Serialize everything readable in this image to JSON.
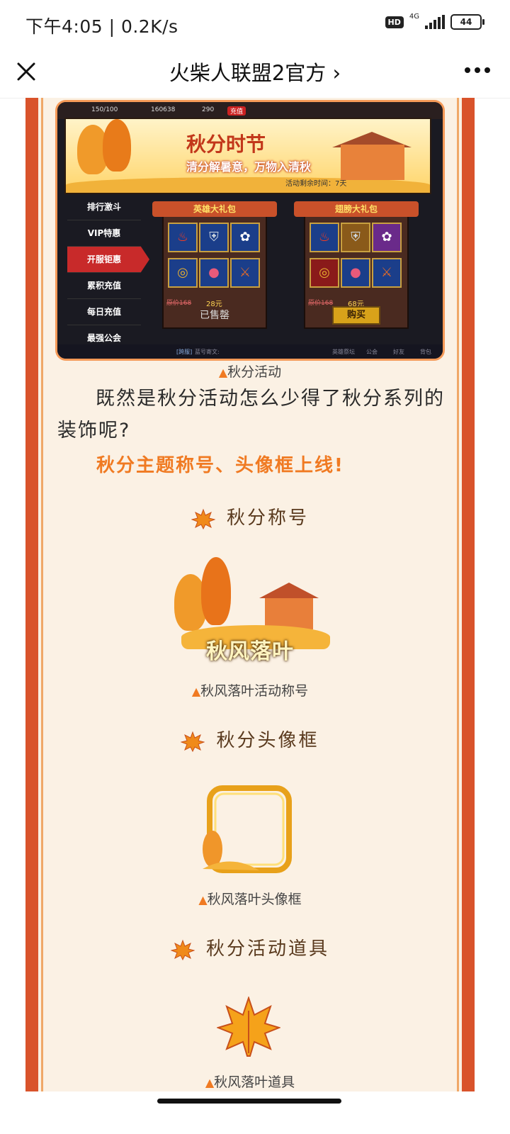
{
  "status_bar": {
    "time": "下午4:05 | 0.2K/s",
    "hd": "HD",
    "network": "4G",
    "battery": "44"
  },
  "nav": {
    "title": "火柴人联盟2官方 ›",
    "close_icon": "close-icon",
    "more_icon": "more-icon"
  },
  "game_screenshot": {
    "top_stats": {
      "energy": "150/100",
      "gold": "160638",
      "gems": "290",
      "recharge": "充值"
    },
    "banner_title": "秋分时节",
    "banner_subtitle": "清分解暑意，万物入清秋",
    "timer": "活动剩余时间：7天",
    "menu": [
      "排行激斗",
      "VIP特惠",
      "开服钜惠",
      "累积充值",
      "每日充值",
      "最强公会"
    ],
    "active_menu": "开服钜惠",
    "packs": [
      {
        "title": "英雄大礼包",
        "old_price": "原价168",
        "price": "28元",
        "status": "已售罄"
      },
      {
        "title": "翅膀大礼包",
        "old_price": "原价168",
        "price": "68元",
        "button": "购买"
      }
    ],
    "bottom": {
      "channel": "[跨服]",
      "hint": "蓝号寄文:",
      "tabs": [
        "英雄祭坛",
        "公会",
        "好友",
        "背包"
      ]
    }
  },
  "captions": {
    "game": "秋分活动",
    "title": "秋风落叶活动称号",
    "frame": "秋风落叶头像框",
    "item": "秋风落叶道具"
  },
  "paragraph": "既然是秋分活动怎么少得了秋分系列的装饰呢?",
  "highlight": "秋分主题称号、头像框上线!",
  "sections": {
    "title": "秋分称号",
    "frame": "秋分头像框",
    "item": "秋分活动道具"
  },
  "title_image_text": "秋风落叶",
  "colors": {
    "accent_orange": "#f07a22",
    "frame_red": "#d9532b",
    "page_bg": "#fbf1e4"
  }
}
